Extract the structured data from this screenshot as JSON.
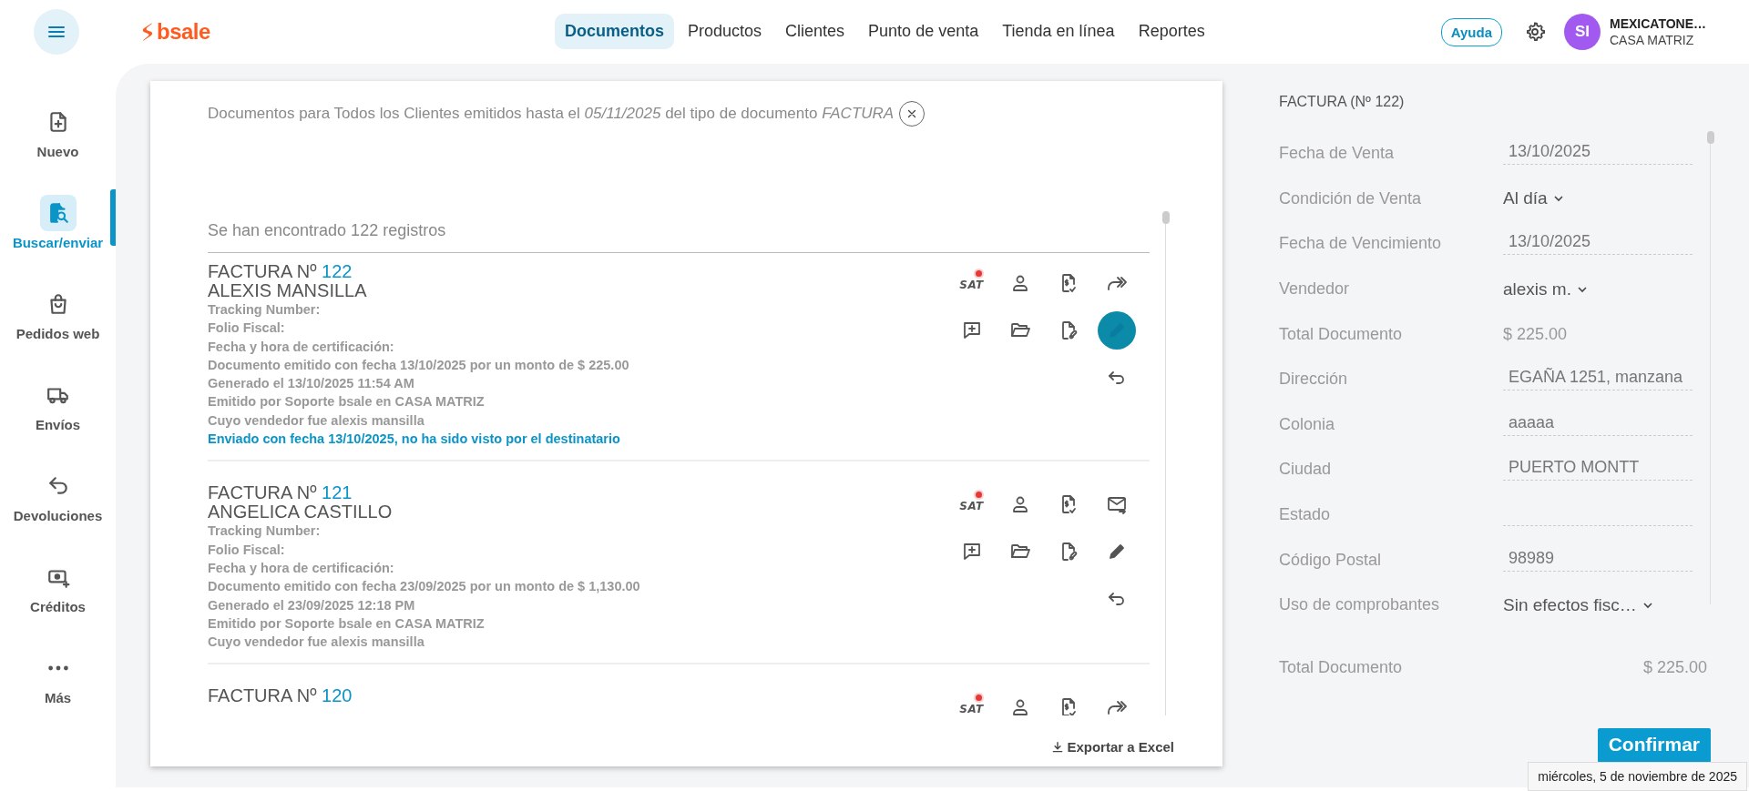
{
  "header": {
    "logo": "bsale",
    "nav": [
      {
        "label": "Documentos",
        "selected": true
      },
      {
        "label": "Productos",
        "selected": false
      },
      {
        "label": "Clientes",
        "selected": false
      },
      {
        "label": "Punto de venta",
        "selected": false
      },
      {
        "label": "Tienda en línea",
        "selected": false
      },
      {
        "label": "Reportes",
        "selected": false
      }
    ],
    "help": "Ayuda",
    "user": {
      "initials": "SI",
      "name": "MEXICATONE…",
      "branch": "CASA MATRIZ"
    }
  },
  "sidebar": {
    "items": [
      {
        "label": "Nuevo",
        "selected": false
      },
      {
        "label": "Buscar/enviar",
        "selected": true
      },
      {
        "label": "Pedidos web",
        "selected": false
      },
      {
        "label": "Envíos",
        "selected": false
      },
      {
        "label": "Devoluciones",
        "selected": false
      },
      {
        "label": "Créditos",
        "selected": false
      },
      {
        "label": "Más",
        "selected": false
      }
    ]
  },
  "search": {
    "filter": "Documentos para Todos los Clientes emitidos hasta el *05/11/2025* del tipo de documento *FACTURA*",
    "count": "Se han encontrado 122 registros",
    "export": "Exportar a Excel"
  },
  "documents": [
    {
      "type": "FACTURA Nº",
      "number": "122",
      "client": "ALEXIS MANSILLA",
      "lines": [
        "Tracking Number:",
        "Folio Fiscal:",
        "Fecha y hora de certificación:",
        "Documento emitido con fecha 13/10/2025 por un monto de $ 225.00",
        "Generado el 13/10/2025 11:54 AM",
        "Emitido por Soporte bsale en CASA MATRIZ",
        "Cuyo vendedor fue alexis mansilla"
      ],
      "sent_note": "Enviado con fecha 13/10/2025, no ha sido visto por el destinatario",
      "sat_alert": true,
      "actions": [
        {
          "kind": "sat",
          "label": "SAT",
          "active": false
        },
        {
          "kind": "client",
          "active": false
        },
        {
          "kind": "payment",
          "active": false
        },
        {
          "kind": "forward",
          "active": false
        },
        {
          "kind": "note",
          "active": false
        },
        {
          "kind": "folder",
          "active": false
        },
        {
          "kind": "link",
          "active": false
        },
        {
          "kind": "edit",
          "active": true
        },
        {
          "kind": "return",
          "active": false
        }
      ]
    },
    {
      "type": "FACTURA Nº",
      "number": "121",
      "client": "ANGELICA CASTILLO",
      "lines": [
        "Tracking Number:",
        "Folio Fiscal:",
        "Fecha y hora de certificación:",
        "Documento emitido con fecha 23/09/2025 por un monto de $ 1,130.00",
        "Generado el 23/09/2025 12:18 PM",
        "Emitido por Soporte bsale en CASA MATRIZ",
        "Cuyo vendedor fue alexis mansilla"
      ],
      "sat_alert": true,
      "actions": [
        {
          "kind": "sat",
          "label": "SAT",
          "active": false
        },
        {
          "kind": "client",
          "active": false
        },
        {
          "kind": "payment",
          "active": false
        },
        {
          "kind": "email",
          "active": false
        },
        {
          "kind": "note",
          "active": false
        },
        {
          "kind": "folder",
          "active": false
        },
        {
          "kind": "link",
          "active": false
        },
        {
          "kind": "edit",
          "active": false
        },
        {
          "kind": "return",
          "active": false
        }
      ]
    },
    {
      "type": "FACTURA Nº",
      "number": "120",
      "sat_alert": true,
      "actions": [
        {
          "kind": "sat",
          "label": "SAT",
          "active": false
        },
        {
          "kind": "client",
          "active": false
        },
        {
          "kind": "payment",
          "active": false
        },
        {
          "kind": "forward",
          "active": false
        }
      ]
    }
  ],
  "detail": {
    "title": "FACTURA (Nº 122)",
    "fields": [
      {
        "label": "Fecha de Venta",
        "kind": "input",
        "value": "13/10/2025"
      },
      {
        "label": "Condición de Venta",
        "kind": "select",
        "value": "Al día"
      },
      {
        "label": "Fecha de Vencimiento",
        "kind": "input",
        "value": "13/10/2025"
      },
      {
        "label": "Vendedor",
        "kind": "select",
        "value": "alexis m."
      },
      {
        "label": "Total Documento",
        "kind": "static",
        "value": "$ 225.00"
      },
      {
        "label": "Dirección",
        "kind": "input",
        "value": "EGAÑA 1251, manzana"
      },
      {
        "label": "Colonia",
        "kind": "input",
        "value": "aaaaa"
      },
      {
        "label": "Ciudad",
        "kind": "input",
        "value": "PUERTO MONTT"
      },
      {
        "label": "Estado",
        "kind": "input"
      },
      {
        "label": "Código Postal",
        "kind": "input",
        "value": "98989"
      },
      {
        "label": "Uso de comprobantes",
        "kind": "select",
        "value": "Sin efectos fisc…"
      }
    ],
    "total": {
      "label": "Total Documento",
      "value": "$ 225.00"
    },
    "confirm": "Confirmar"
  },
  "tooltip": "miércoles, 5 de noviembre de 2025"
}
